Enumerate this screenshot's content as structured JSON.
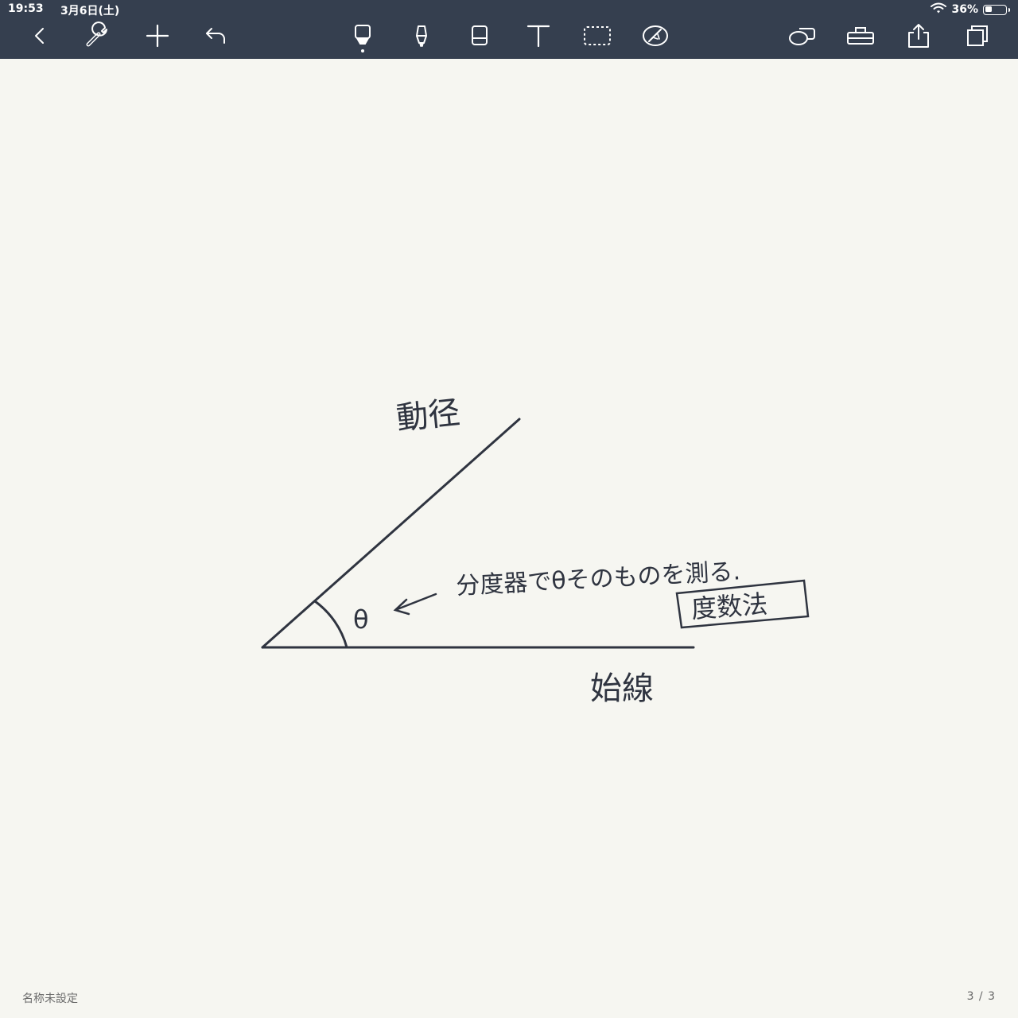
{
  "status_bar": {
    "time": "19:53",
    "date": "3月6日(土)",
    "battery_text": "36%",
    "battery_level": 0.36
  },
  "toolbar": {
    "left": [
      {
        "name": "back-button",
        "icon": "chevron-left-icon"
      },
      {
        "name": "settings-button",
        "icon": "wrench-icon"
      },
      {
        "name": "add-button",
        "icon": "plus-icon"
      },
      {
        "name": "undo-button",
        "icon": "undo-icon"
      }
    ],
    "center": [
      {
        "name": "pen-tool-button",
        "icon": "pen-icon",
        "active": true
      },
      {
        "name": "highlighter-tool-button",
        "icon": "highlighter-icon"
      },
      {
        "name": "eraser-tool-button",
        "icon": "eraser-icon"
      },
      {
        "name": "text-tool-button",
        "icon": "text-icon"
      },
      {
        "name": "lasso-tool-button",
        "icon": "lasso-icon"
      },
      {
        "name": "laser-pointer-button",
        "icon": "laser-pointer-icon"
      }
    ],
    "right": [
      {
        "name": "layers-button",
        "icon": "layers-icon"
      },
      {
        "name": "page-tools-button",
        "icon": "page-tools-icon"
      },
      {
        "name": "share-button",
        "icon": "share-icon"
      },
      {
        "name": "pages-button",
        "icon": "pages-icon"
      }
    ]
  },
  "drawing": {
    "label_terminal": "動径",
    "label_initial": "始線",
    "label_theta": "θ",
    "note": "分度器でθそのものを測る.",
    "boxed_term": "度数法"
  },
  "footer": {
    "document_title": "名称未設定",
    "page_indicator": "3 / 3"
  },
  "colors": {
    "toolbar_bg": "#353f4f",
    "paper": "#f6f6f1",
    "ink": "#2f3440"
  }
}
